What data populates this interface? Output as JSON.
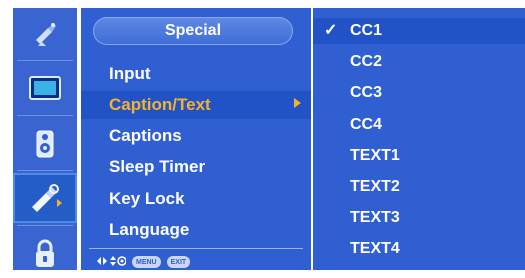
{
  "icon_column": {
    "icons": [
      "satellite-dish-icon",
      "picture-icon",
      "audio-icon",
      "special-tools-icon",
      "lock-icon"
    ],
    "selected": "special-tools-icon"
  },
  "menu": {
    "header": "Special",
    "items": [
      {
        "label": "Input"
      },
      {
        "label": "Caption/Text"
      },
      {
        "label": "Captions"
      },
      {
        "label": "Sleep Timer"
      },
      {
        "label": "Key Lock"
      },
      {
        "label": "Language"
      }
    ],
    "active_item": "Caption/Text",
    "legend": {
      "move_symbols": "◂▸ ⬍",
      "menu_key": "MENU",
      "exit_key": "EXIT"
    }
  },
  "submenu": {
    "check_mark": "✓",
    "options": [
      "CC1",
      "CC2",
      "CC3",
      "CC4",
      "TEXT1",
      "TEXT2",
      "TEXT3",
      "TEXT4"
    ],
    "selected": "CC1"
  },
  "colors": {
    "panel_blue": "#2f5fd0",
    "highlight_blue": "#2253c6",
    "active_text": "#f3b12c"
  }
}
